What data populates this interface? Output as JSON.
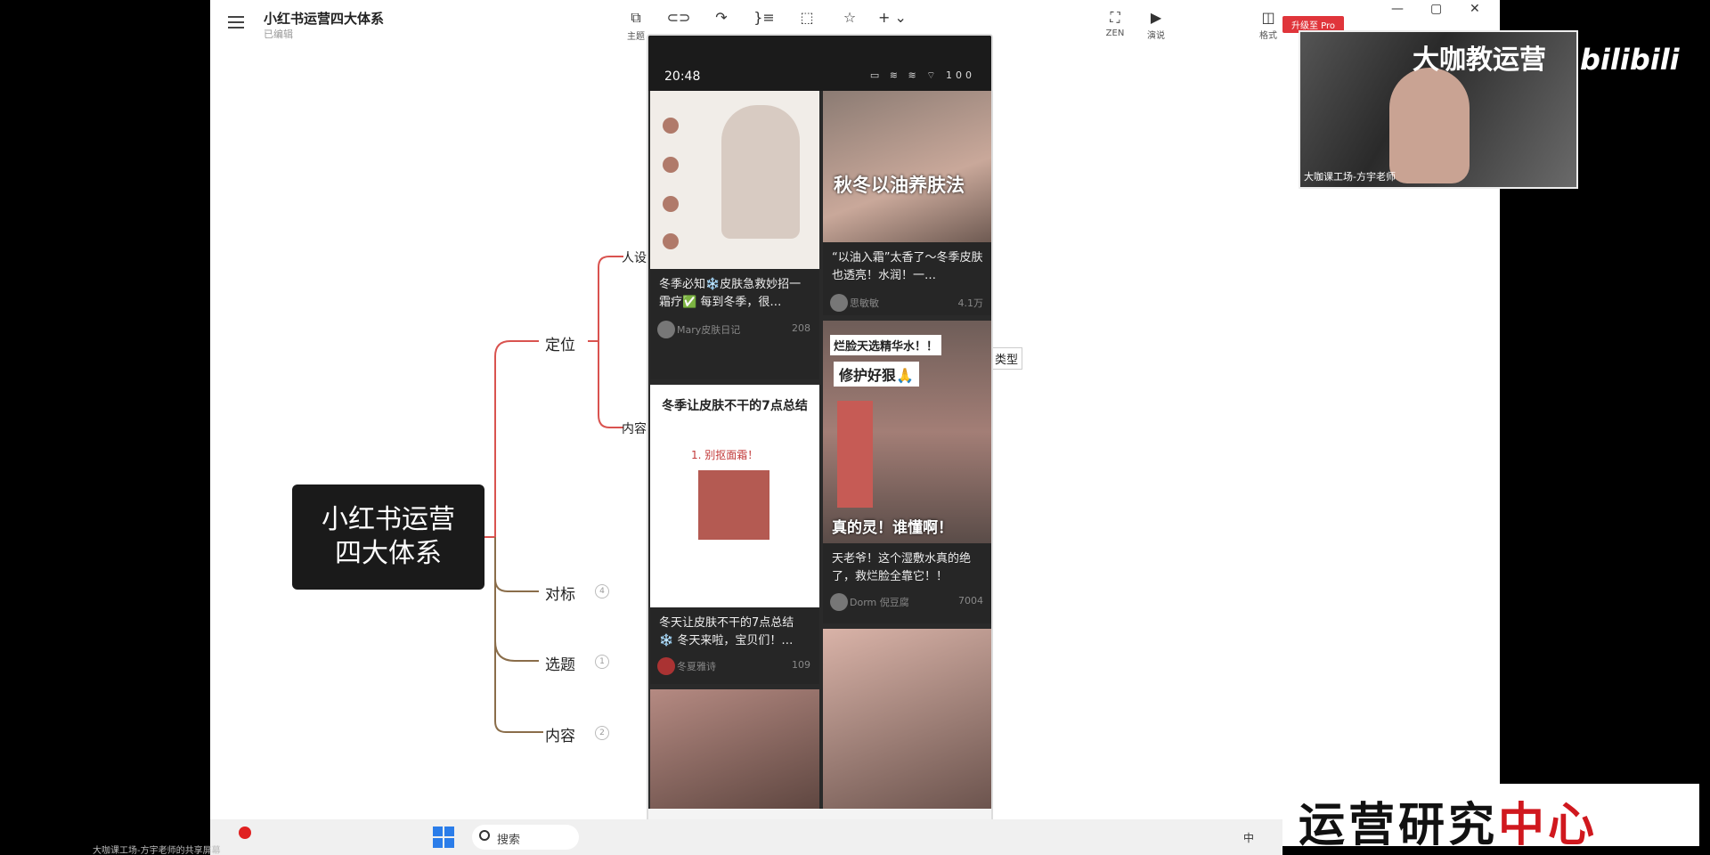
{
  "app": {
    "title": "小红书运营四大体系",
    "subtitle": "已编辑",
    "toolbar": [
      {
        "icon": "theme-icon",
        "label": "主题"
      },
      {
        "icon": "subtopic-icon",
        "label": ""
      },
      {
        "icon": "relation-icon",
        "label": ""
      },
      {
        "icon": "summary-icon",
        "label": ""
      },
      {
        "icon": "boundary-icon",
        "label": ""
      },
      {
        "icon": "star-icon",
        "label": ""
      },
      {
        "icon": "insert-icon",
        "label": "+ ⌄"
      }
    ],
    "right_tools": [
      {
        "icon": "zen-icon",
        "label": "ZEN"
      },
      {
        "icon": "present-icon",
        "label": "演说"
      },
      {
        "icon": "format-icon",
        "label": "格式"
      }
    ]
  },
  "mindmap": {
    "root": "小红书运营\n四大体系",
    "root_line1": "小红书运营",
    "root_line2": "四大体系",
    "branches": [
      {
        "label": "定位"
      },
      {
        "label": "对标",
        "badge": "4"
      },
      {
        "label": "选题",
        "badge": "1"
      },
      {
        "label": "内容",
        "badge": "2"
      }
    ],
    "sub_branches": [
      {
        "label": "人设"
      },
      {
        "label": "内容"
      }
    ],
    "side_tag": "类型"
  },
  "phone": {
    "time": "20:48",
    "status_icons": "▭ ≋ ≋ ⌔ 100",
    "cards": [
      {
        "title": "冬季必知❄️皮肤急救妙招一霜疗✅ 每到冬季，很…",
        "author": "Mary皮肤日记",
        "likes": "208"
      },
      {
        "overlay": "秋冬以油养肤法",
        "title": "“以油入霜”太香了～冬季皮肤也透亮！水润！一…",
        "author": "思敏敏",
        "likes": "4.1万"
      },
      {
        "overlay_top": "烂脸天选精华水！！",
        "overlay_mid": "修护好狠🙏",
        "overlay_bottom": "真的灵！谁懂啊！",
        "title": "天老爷！这个湿敷水真的绝了，救烂脸全靠它！！",
        "author": "Dorm 倪豆腐",
        "likes": "7004"
      },
      {
        "poster_title": "冬季让皮肤不干的7点总结",
        "poster_item": "1. 别抠面霜！",
        "title": "冬天让皮肤不干的7点总结 ❄️ 冬天来啦，宝贝们！…",
        "author": "冬夏雅诗",
        "likes": "109"
      }
    ],
    "nav": [
      "☰",
      "▢",
      "‹"
    ]
  },
  "webcam": {
    "brand": "大咖教运营",
    "caption": "大咖课工场-方宇老师",
    "upgrade": "升级至 Pro"
  },
  "bilibili": "bilibili",
  "watermark": {
    "black": "运营研究",
    "red": "中心"
  },
  "taskbar": {
    "search": "搜索",
    "ime": "中",
    "caption": "大咖课工场-方宇老师的共享屏幕"
  }
}
